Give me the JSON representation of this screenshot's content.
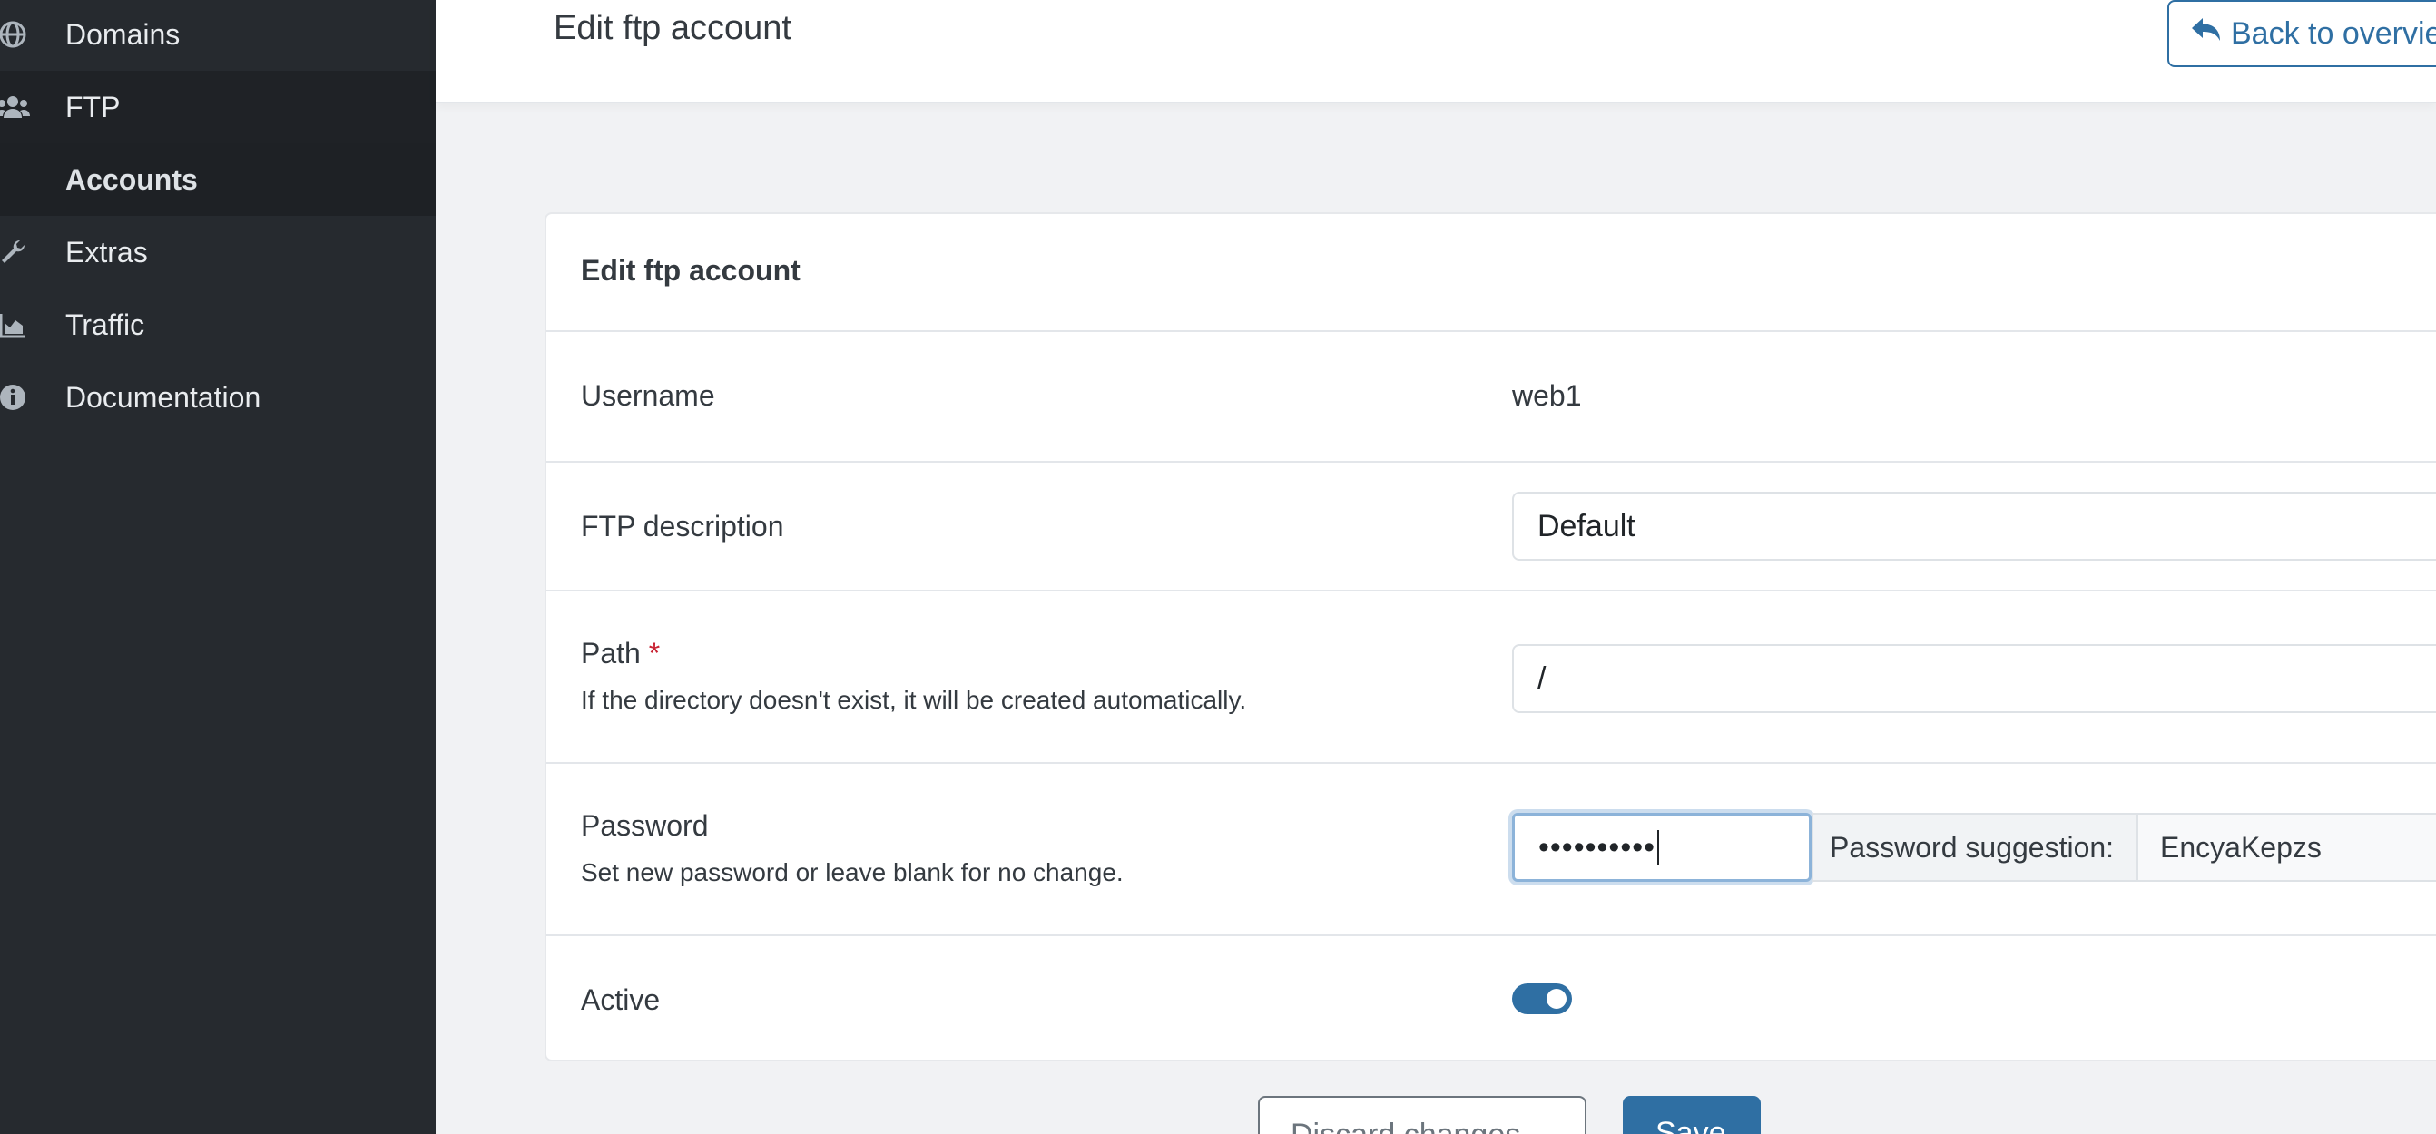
{
  "sidebar": {
    "items": [
      {
        "label": "Domains",
        "icon": "globe-icon"
      },
      {
        "label": "FTP",
        "icon": "users-icon"
      },
      {
        "label": "Accounts"
      },
      {
        "label": "Extras",
        "icon": "wrench-icon"
      },
      {
        "label": "Traffic",
        "icon": "chart-area-icon"
      },
      {
        "label": "Documentation",
        "icon": "info-circle-icon"
      }
    ]
  },
  "header": {
    "title": "Edit ftp account",
    "back_label": "Back to overview"
  },
  "card": {
    "title": "Edit ftp account",
    "username": {
      "label": "Username",
      "value": "web1"
    },
    "description": {
      "label": "FTP description",
      "value": "Default"
    },
    "path": {
      "label": "Path",
      "required_mark": "*",
      "hint": "If the directory doesn't exist, it will be created automatically.",
      "value": "/"
    },
    "password": {
      "label": "Password",
      "hint": "Set new password or leave blank for no change.",
      "value": "••••••••••",
      "suggestion_label": "Password suggestion:",
      "suggestion_value": "EncyaKepzs"
    },
    "active": {
      "label": "Active",
      "checked": true
    }
  },
  "actions": {
    "discard_label": "Discard changes",
    "save_label": "Save"
  },
  "colors": {
    "sidebar_bg": "#262a2f",
    "accent": "#2f6fa3",
    "required": "#c82333"
  }
}
